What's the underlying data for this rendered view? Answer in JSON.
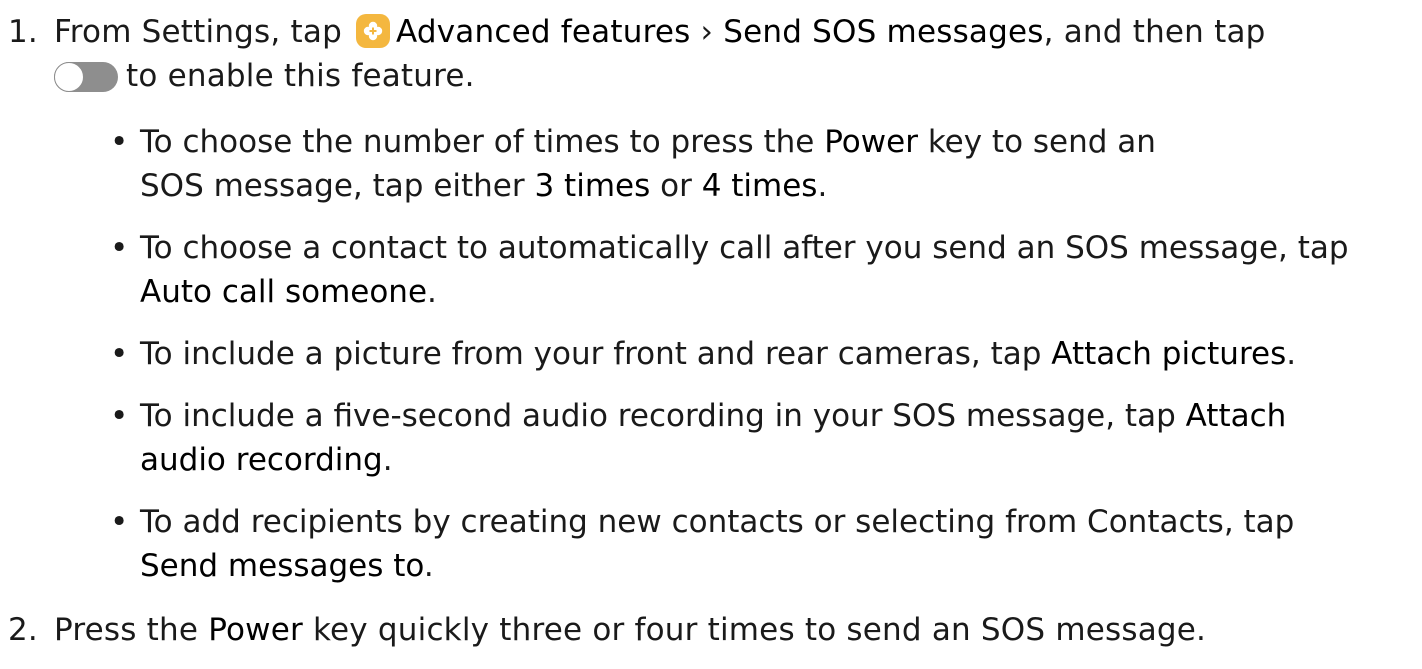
{
  "steps": [
    {
      "number": "1.",
      "line1_a": "From Settings, tap",
      "icon": "advanced-features-icon",
      "line1_b": "Advanced features",
      "sep": "›",
      "line1_c": "Send SOS messages",
      "line1_d": ", and then tap",
      "toggle": "toggle-switch-icon",
      "line2": "to enable this feature."
    },
    {
      "number": "2.",
      "text_a": "Press the",
      "text_b": "Power",
      "text_c": "key quickly three or four times to send an SOS message."
    }
  ],
  "bullets": [
    {
      "l1_a": "To choose the number of times to press the",
      "l1_b": "Power",
      "l1_c": "key to send an",
      "l2_a": "SOS message, tap either",
      "l2_b": "3 times",
      "l2_c": "or",
      "l2_d": "4 times",
      "l2_e": "."
    },
    {
      "l1_a": "To choose a contact to automatically call after you send an SOS message, tap",
      "l2_b": "Auto call someone",
      "l2_e": "."
    },
    {
      "l1_a": "To include a picture from your front and rear cameras, tap",
      "l1_b": "Attach pictures",
      "l1_c": "."
    },
    {
      "l1_a": "To include a five-second audio recording in your SOS message, tap",
      "l1_b": "Attach",
      "l2_b": "audio recording",
      "l2_e": "."
    },
    {
      "l1_a": "To add recipients by creating new contacts or selecting from Contacts, tap",
      "l2_b": "Send messages to",
      "l2_e": "."
    }
  ],
  "bullet_char": "•",
  "colors": {
    "icon_bg": "#f4b73f",
    "toggle_track": "#8e8e8e",
    "text": "#1a1a1a"
  }
}
